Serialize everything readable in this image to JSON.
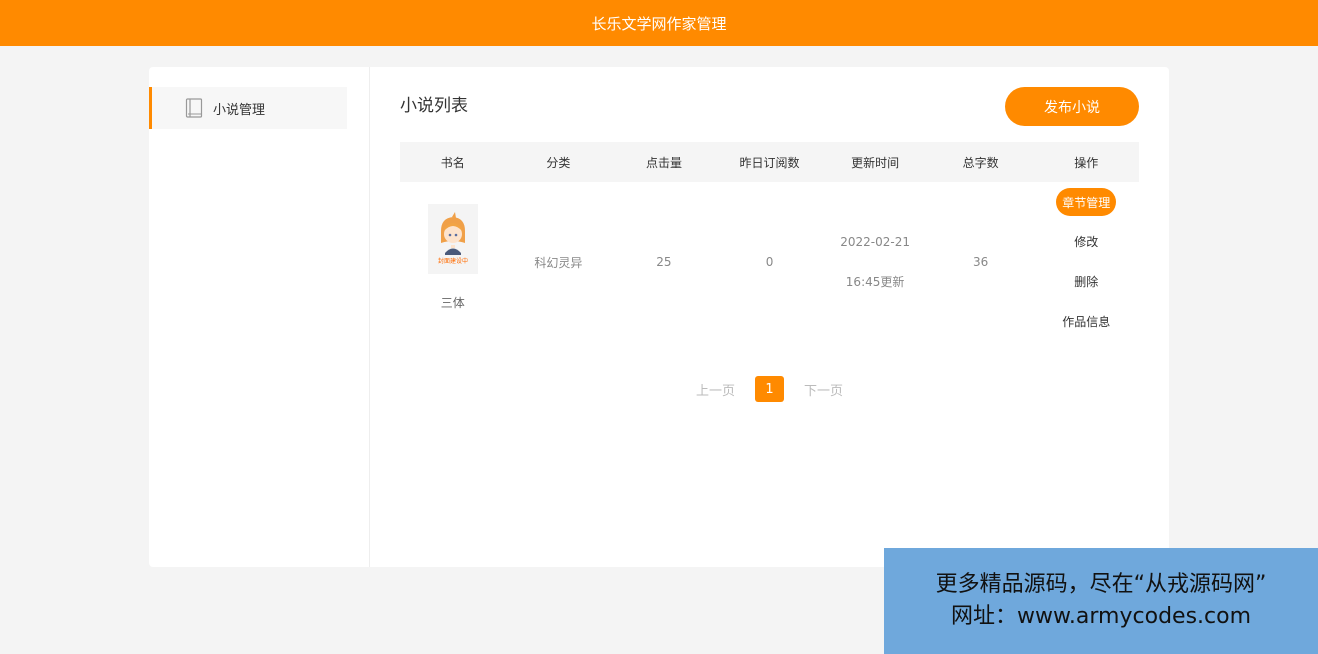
{
  "header": {
    "title": "长乐文学网作家管理"
  },
  "sidebar": {
    "items": [
      {
        "label": "小说管理",
        "icon": "book-icon"
      }
    ]
  },
  "main": {
    "title": "小说列表",
    "publish_label": "发布小说",
    "columns": [
      "书名",
      "分类",
      "点击量",
      "昨日订阅数",
      "更新时间",
      "总字数",
      "操作"
    ],
    "rows": [
      {
        "name": "三体",
        "cover_caption": "封面建设中",
        "category": "科幻灵异",
        "clicks": "25",
        "yesterday_subs": "0",
        "update_date": "2022-02-21",
        "update_time": "16:45更新",
        "word_count": "36",
        "ops": {
          "chapters": "章节管理",
          "edit": "修改",
          "delete": "删除",
          "info": "作品信息"
        }
      }
    ],
    "pager": {
      "prev": "上一页",
      "current": "1",
      "next": "下一页"
    }
  },
  "watermark": {
    "line1": "更多精品源码，尽在“从戎源码网”",
    "line2": "网址：www.armycodes.com"
  },
  "colors": {
    "accent": "#ff8a00",
    "watermark_bg": "#6fa8dc"
  }
}
